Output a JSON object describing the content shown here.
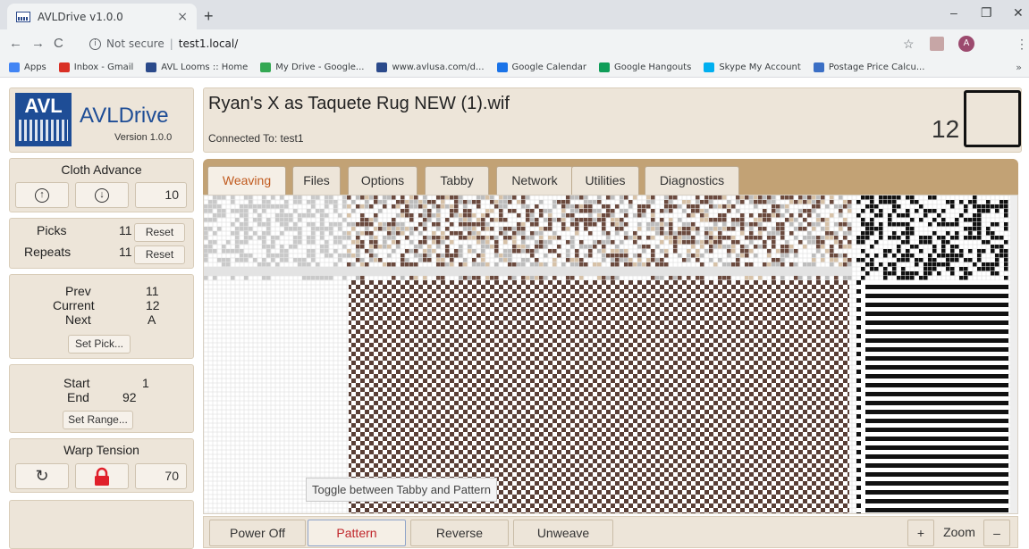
{
  "browser": {
    "tab_title": "AVLDrive v1.0.0",
    "tab_close": "×",
    "new_tab": "+",
    "security_label": "Not secure",
    "url": "test1.local/",
    "back": "←",
    "forward": "→",
    "reload": "C",
    "star": "☆",
    "avatar": "A",
    "menu": "⋮",
    "minimize": "–",
    "maximize": "❐",
    "close": "✕",
    "bookmarks": [
      {
        "label": "Apps",
        "color": "#4285f4"
      },
      {
        "label": "Inbox - Gmail",
        "color": "#d93025"
      },
      {
        "label": "AVL Looms :: Home",
        "color": "#2b4a8b"
      },
      {
        "label": "My Drive - Google...",
        "color": "#34a853"
      },
      {
        "label": "www.avlusa.com/d...",
        "color": "#2b4a8b"
      },
      {
        "label": "Google Calendar",
        "color": "#1a73e8"
      },
      {
        "label": "Google Hangouts",
        "color": "#0f9d58"
      },
      {
        "label": "Skype My Account",
        "color": "#00aff0"
      },
      {
        "label": "Postage Price Calcu...",
        "color": "#3b6fc5"
      }
    ],
    "bookmarks_more": "»"
  },
  "app": {
    "logo_text": "AVL",
    "name": "AVLDrive",
    "version": "Version 1.0.0",
    "file_title": "Ryan's X as Taquete Rug NEW (1).wif",
    "connected": "Connected To: test1",
    "current_pick_display": "12"
  },
  "cloth_advance": {
    "title": "Cloth Advance",
    "up_icon": "↑",
    "down_icon": "↓",
    "value": "10"
  },
  "counters": {
    "picks_label": "Picks",
    "picks_value": "11",
    "repeats_label": "Repeats",
    "repeats_value": "11",
    "reset_label": "Reset"
  },
  "pick_info": {
    "prev_label": "Prev",
    "prev_value": "11",
    "current_label": "Current",
    "current_value": "12",
    "next_label": "Next",
    "next_value": "A",
    "set_pick": "Set Pick..."
  },
  "range": {
    "start_label": "Start",
    "start_value": "1",
    "end_label": "End",
    "end_value": "92",
    "set_range": "Set Range..."
  },
  "warp_tension": {
    "title": "Warp Tension",
    "refresh_icon": "↻",
    "value": "70"
  },
  "tabs": [
    "Weaving",
    "Files",
    "Options",
    "Tabby",
    "Network",
    "Utilities",
    "Diagnostics"
  ],
  "tooltip": "Toggle between Tabby and Pattern",
  "bottom": {
    "power_off": "Power Off",
    "pattern": "Pattern",
    "reverse": "Reverse",
    "unweave": "Unweave",
    "zoom_in": "+",
    "zoom_label": "Zoom",
    "zoom_out": "–"
  },
  "colors": {
    "accent": "#c05a1e",
    "panel": "#ede5d9",
    "tabbar": "#c2a275",
    "logo": "#1e4d96",
    "lock": "#e0202a"
  }
}
